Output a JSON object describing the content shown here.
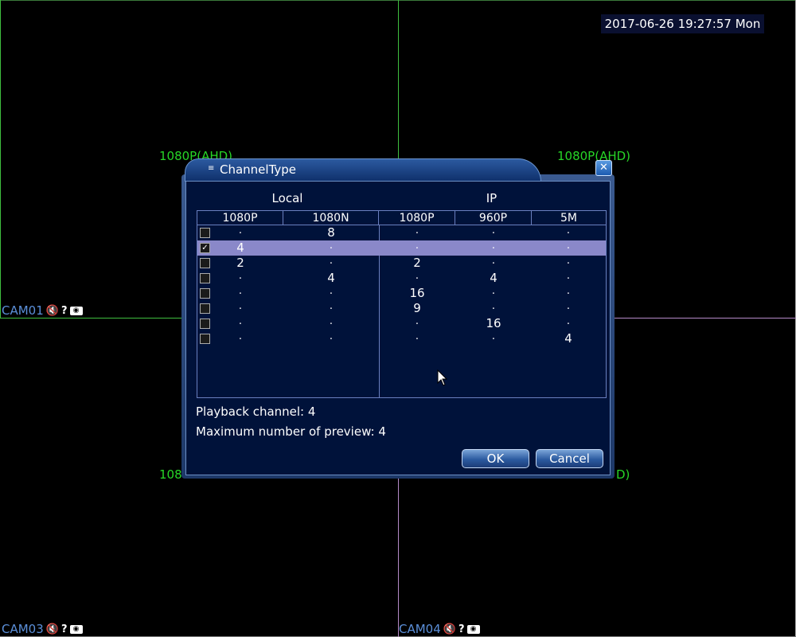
{
  "datetime": "2017-06-26 19:27:57 Mon",
  "quadrants": {
    "resolution_label": "1080P(AHD)",
    "resolution_label_partial_left": "108",
    "resolution_label_partial_right": "D)",
    "cameras": [
      {
        "name": "CAM01"
      },
      {
        "name": "CAM03"
      },
      {
        "name": "CAM04"
      }
    ],
    "cam_icons": {
      "audio": "speaker-muted-icon",
      "unknown": "question-icon",
      "record": "camera-icon"
    }
  },
  "dialog": {
    "title": "ChannelType",
    "close_glyph": "✕",
    "groups": {
      "local": "Local",
      "ip": "IP"
    },
    "columns": [
      "1080P",
      "1080N",
      "1080P",
      "960P",
      "5M"
    ],
    "rows": [
      {
        "checked": false,
        "selected": false,
        "values": [
          ".",
          "8",
          ".",
          ".",
          "."
        ]
      },
      {
        "checked": true,
        "selected": true,
        "values": [
          "4",
          ".",
          ".",
          ".",
          "."
        ]
      },
      {
        "checked": false,
        "selected": false,
        "values": [
          "2",
          ".",
          "2",
          ".",
          "."
        ]
      },
      {
        "checked": false,
        "selected": false,
        "values": [
          ".",
          "4",
          ".",
          "4",
          "."
        ]
      },
      {
        "checked": false,
        "selected": false,
        "values": [
          ".",
          ".",
          "16",
          ".",
          "."
        ]
      },
      {
        "checked": false,
        "selected": false,
        "values": [
          ".",
          ".",
          "9",
          ".",
          "."
        ]
      },
      {
        "checked": false,
        "selected": false,
        "values": [
          ".",
          ".",
          ".",
          "16",
          "."
        ]
      },
      {
        "checked": false,
        "selected": false,
        "values": [
          ".",
          ".",
          ".",
          ".",
          "4"
        ]
      }
    ],
    "playback_channel": "Playback channel: 4",
    "max_preview": "Maximum number of preview: 4",
    "ok_label": "OK",
    "cancel_label": "Cancel"
  }
}
